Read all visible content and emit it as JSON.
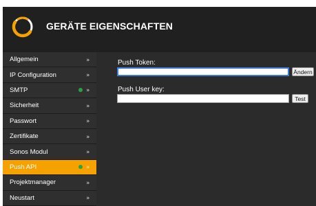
{
  "header": {
    "title": "GERÄTE EIGENSCHAFTEN",
    "logo_icon": "ring-logo-icon"
  },
  "colors": {
    "accent": "#f5a200",
    "status_green": "#2ea043",
    "panel": "#2b2b2b",
    "header": "#202020"
  },
  "sidebar": {
    "items": [
      {
        "label": "Allgemein",
        "chevron": "»"
      },
      {
        "label": "IP Configuration",
        "chevron": "»"
      },
      {
        "label": "SMTP",
        "chevron": "»",
        "status": "green"
      },
      {
        "label": "Sicherheit",
        "chevron": "»"
      },
      {
        "label": "Passwort",
        "chevron": "»"
      },
      {
        "label": "Zertifikate",
        "chevron": "»"
      },
      {
        "label": "Sonos Modul",
        "chevron": "»"
      },
      {
        "label": "Push API",
        "chevron": "»",
        "status": "green",
        "active": true
      },
      {
        "label": "Projektmanager",
        "chevron": "»"
      },
      {
        "label": "Neustart",
        "chevron": "»"
      }
    ]
  },
  "form": {
    "push_token": {
      "label": "Push Token:",
      "value": "",
      "button": "Ändern"
    },
    "push_user_key": {
      "label": "Push User key:",
      "value": "",
      "button": "Test"
    }
  }
}
